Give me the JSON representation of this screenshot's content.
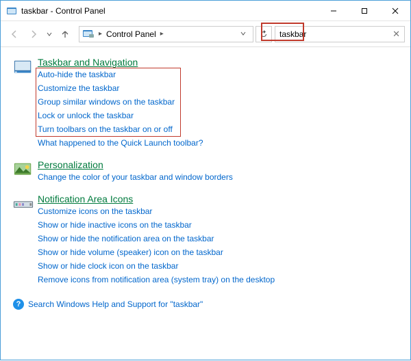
{
  "window": {
    "title": "taskbar - Control Panel"
  },
  "nav": {
    "breadcrumb_root": "Control Panel",
    "search_value": "taskbar"
  },
  "sections": {
    "taskbar_nav": {
      "title": "Taskbar and Navigation",
      "links": {
        "l0": "Auto-hide the taskbar",
        "l1": "Customize the taskbar",
        "l2": "Group similar windows on the taskbar",
        "l3": "Lock or unlock the taskbar",
        "l4": "Turn toolbars on the taskbar on or off",
        "l5": "What happened to the Quick Launch toolbar?"
      }
    },
    "personalization": {
      "title": "Personalization",
      "links": {
        "l0": "Change the color of your taskbar and window borders"
      }
    },
    "notification": {
      "title": "Notification Area Icons",
      "links": {
        "l0": "Customize icons on the taskbar",
        "l1": "Show or hide inactive icons on the taskbar",
        "l2": "Show or hide the notification area on the taskbar",
        "l3": "Show or hide volume (speaker) icon on the taskbar",
        "l4": "Show or hide clock icon on the taskbar",
        "l5": "Remove icons from notification area (system tray) on the desktop"
      }
    }
  },
  "footer": {
    "help_text": "Search Windows Help and Support for \"taskbar\""
  }
}
